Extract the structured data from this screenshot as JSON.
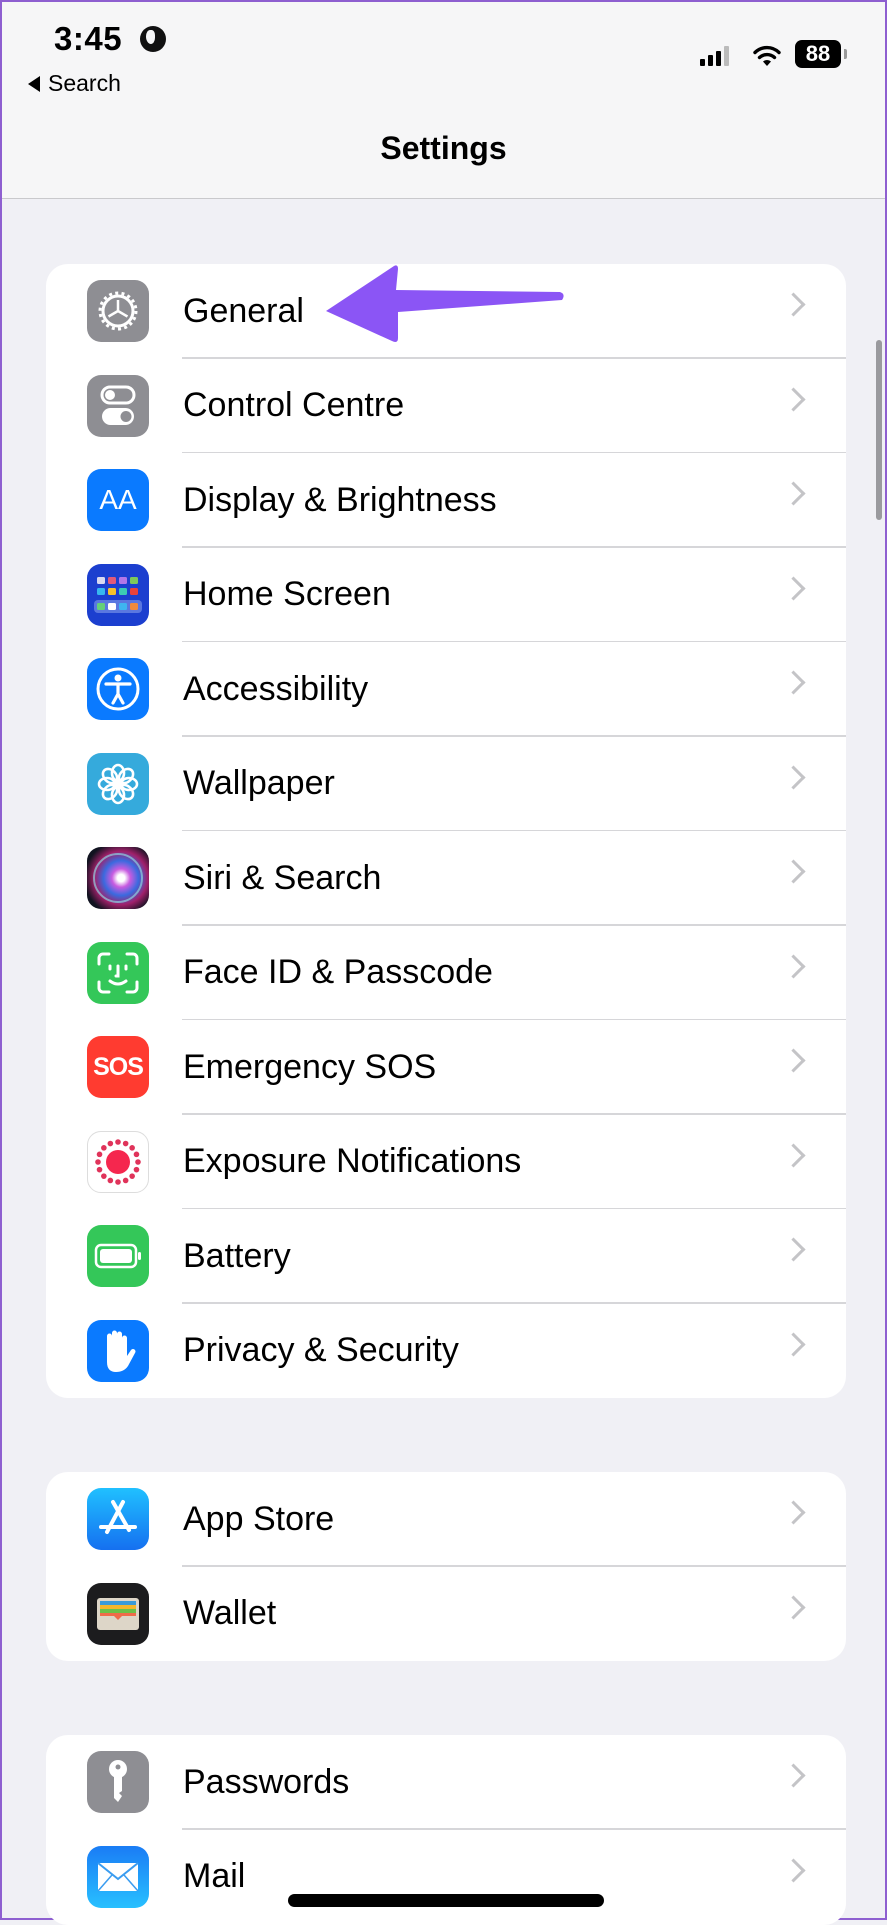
{
  "status_bar": {
    "time": "3:45",
    "back_label": "Search",
    "battery_level": "88",
    "signal_bars_active": 3,
    "signal_bars_total": 4
  },
  "header": {
    "title": "Settings"
  },
  "annotation": {
    "type": "arrow",
    "color": "#8b55f5",
    "points_to": "General"
  },
  "groups": [
    {
      "items": [
        {
          "label": "General",
          "icon": "gear-icon",
          "color": "#8e8e93"
        },
        {
          "label": "Control Centre",
          "icon": "toggles-icon",
          "color": "#8e8e93"
        },
        {
          "label": "Display & Brightness",
          "icon": "text-size-icon",
          "color": "#0a7aff"
        },
        {
          "label": "Home Screen",
          "icon": "app-grid-icon",
          "color": "#1c3fcf"
        },
        {
          "label": "Accessibility",
          "icon": "accessibility-icon",
          "color": "#0a7aff"
        },
        {
          "label": "Wallpaper",
          "icon": "flower-icon",
          "color": "#35aadc"
        },
        {
          "label": "Siri & Search",
          "icon": "siri-icon",
          "color": "#1a1a2e"
        },
        {
          "label": "Face ID & Passcode",
          "icon": "face-id-icon",
          "color": "#34c759"
        },
        {
          "label": "Emergency SOS",
          "icon": "sos-icon",
          "color": "#ff3b30"
        },
        {
          "label": "Exposure Notifications",
          "icon": "exposure-icon",
          "color": "#ffffff"
        },
        {
          "label": "Battery",
          "icon": "battery-icon",
          "color": "#34c759"
        },
        {
          "label": "Privacy & Security",
          "icon": "hand-icon",
          "color": "#0a7aff"
        }
      ]
    },
    {
      "items": [
        {
          "label": "App Store",
          "icon": "app-store-icon",
          "color": "#1a8cff"
        },
        {
          "label": "Wallet",
          "icon": "wallet-icon",
          "color": "#1c1c1e"
        }
      ]
    },
    {
      "items": [
        {
          "label": "Passwords",
          "icon": "key-icon",
          "color": "#8e8e93"
        },
        {
          "label": "Mail",
          "icon": "mail-icon",
          "color": "#1a8cff"
        }
      ]
    }
  ],
  "sos_text": "SOS",
  "aa_text": "AA"
}
